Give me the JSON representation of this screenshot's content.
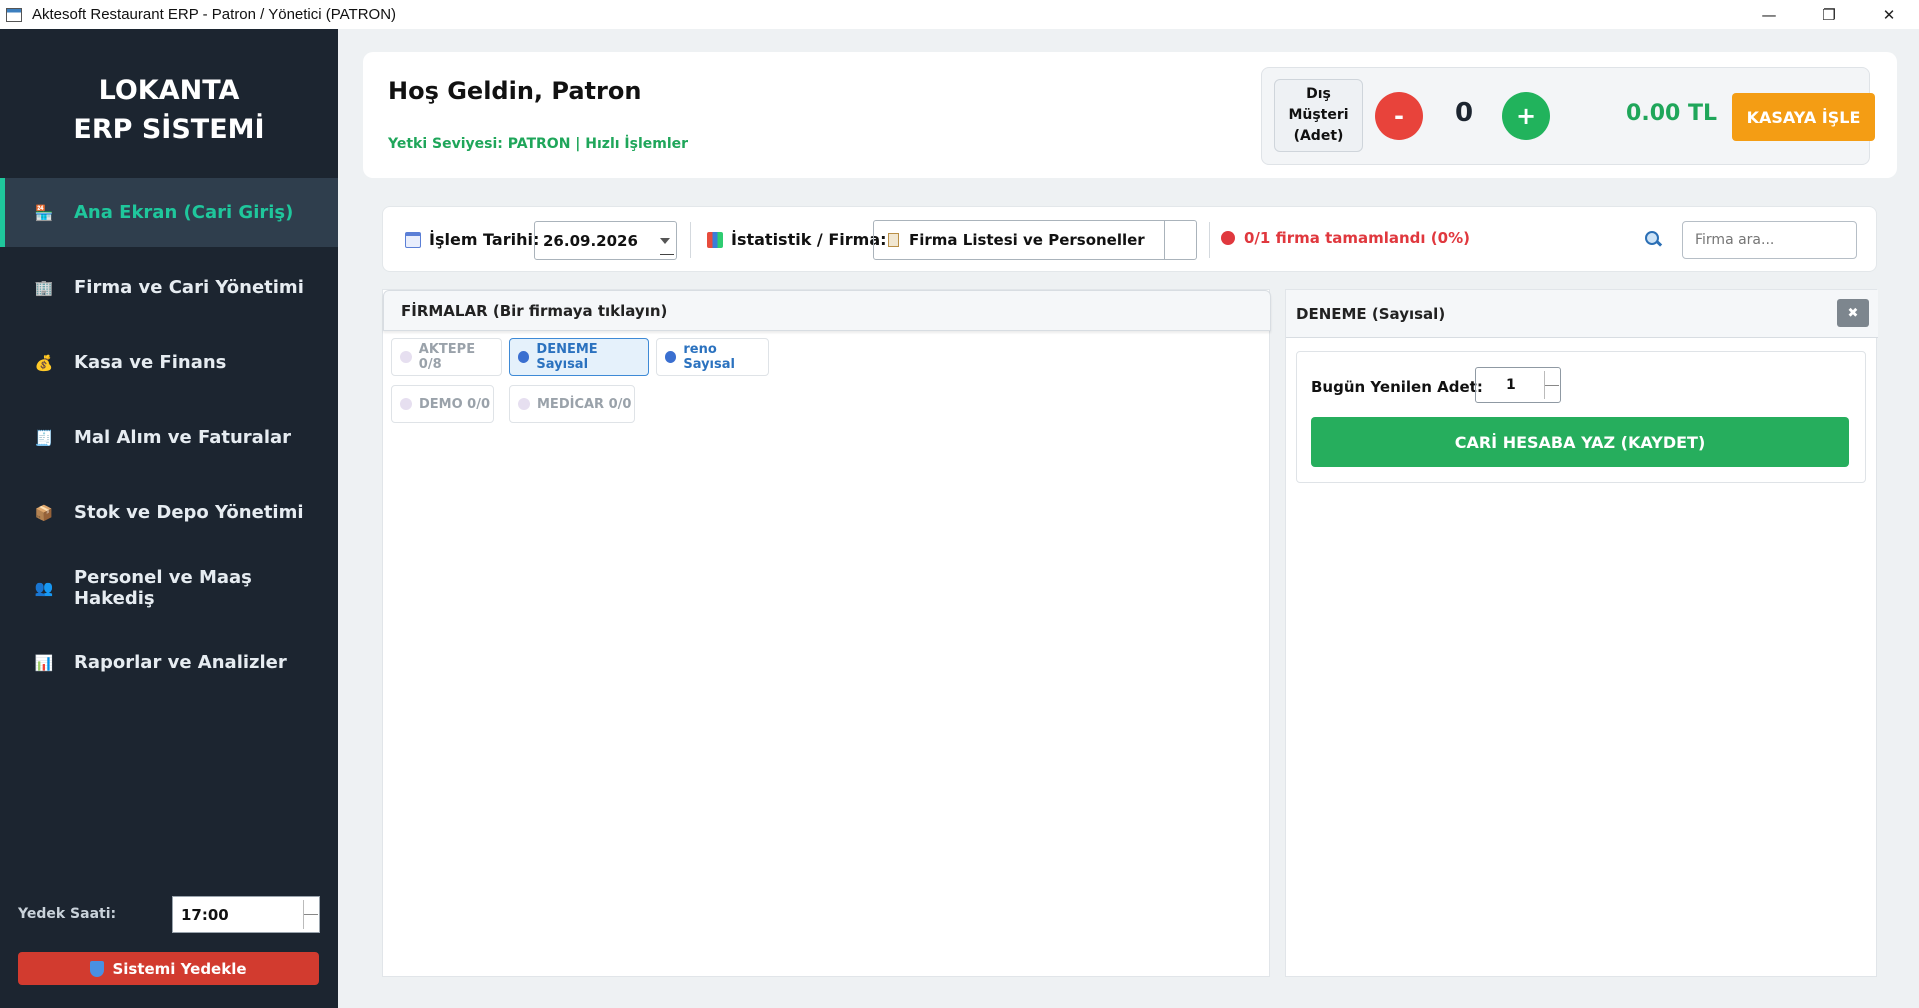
{
  "window": {
    "title": "Aktesoft Restaurant ERP - Patron / Yönetici (PATRON)",
    "minimize": "—",
    "restore": "❐",
    "close": "✕"
  },
  "sidebar": {
    "brand_line1": "LOKANTA",
    "brand_line2": "ERP SİSTEMİ",
    "items": [
      {
        "label": "Ana Ekran (Cari Giriş)",
        "icon": "🏪",
        "active": true
      },
      {
        "label": "Firma ve Cari Yönetimi",
        "icon": "🏢"
      },
      {
        "label": "Kasa ve Finans",
        "icon": "💰"
      },
      {
        "label": "Mal Alım ve Faturalar",
        "icon": "🧾"
      },
      {
        "label": "Stok ve Depo Yönetimi",
        "icon": "📦"
      },
      {
        "label": "Personel ve Maaş Hakediş",
        "icon": "👥"
      },
      {
        "label": "Raporlar ve Analizler",
        "icon": "📊"
      }
    ],
    "backup_label": "Yedek Saati:",
    "backup_time": "17:00",
    "backup_button": "Sistemi Yedekle"
  },
  "header": {
    "welcome": "Hoş Geldin, Patron",
    "role": "Yetki Seviyesi: PATRON | Hızlı İşlemler",
    "external_label_1": "Dış Müşteri",
    "external_label_2": "(Adet)",
    "minus": "-",
    "plus": "+",
    "count": "0",
    "amount": "0.00 TL",
    "kasa_button": "KASAYA İŞLE"
  },
  "filter": {
    "date_label": "İşlem Tarihi:",
    "date_value": "26.09.2026",
    "stat_label": "İstatistik / Firma:",
    "stat_value": "Firma Listesi ve Personeller",
    "progress": "0/1 firma tamamlandı (0%)",
    "search_placeholder": "Firma ara..."
  },
  "firms": {
    "header": "FİRMALAR (Bir firmaya tıklayın)",
    "chips": [
      "AKTEPE 0/8",
      "DENEME Sayısal",
      "reno Sayısal",
      "DEMO 0/0",
      "MEDİCAR 0/0"
    ]
  },
  "detail": {
    "title": "DENEME (Sayısal)",
    "close": "✖",
    "qty_label": "Bugün Yenilen Adet:",
    "qty_value": "1",
    "save_button": "CARİ HESABA YAZ (KAYDET)"
  },
  "colors": {
    "sidebar_bg": "#1c2530",
    "accent": "#1fc79c",
    "green": "#26ae5d",
    "red": "#e0383e",
    "orange": "#f49d14"
  }
}
